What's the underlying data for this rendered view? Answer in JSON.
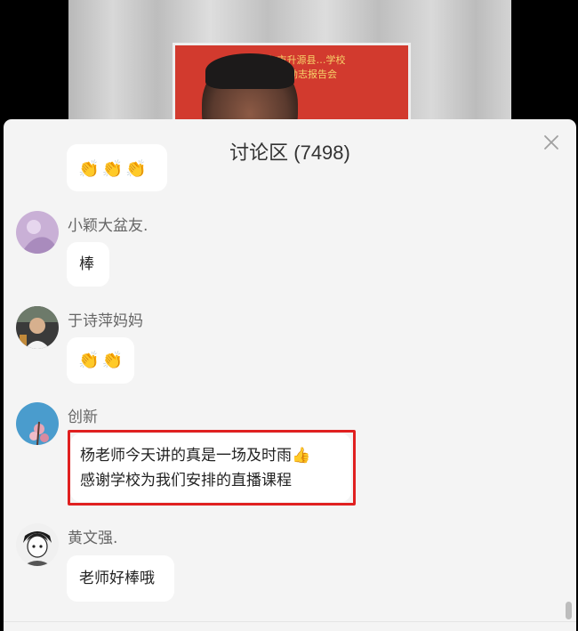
{
  "video": {
    "banner_line1": "齐齐哈尔市升源县…学校",
    "banner_line2": "20…线上励志报告会"
  },
  "panel": {
    "title": "讨论区 (7498)"
  },
  "messages": [
    {
      "name": "",
      "content": [
        "👏👏👏"
      ],
      "avatar": "none"
    },
    {
      "name": "小颖大盆友.",
      "content": [
        "棒"
      ],
      "avatar": "lilac-avatar"
    },
    {
      "name": "于诗萍妈妈",
      "content": [
        "👏👏"
      ],
      "avatar": "child-photo-avatar"
    },
    {
      "name": "创新",
      "content": [
        "杨老师今天讲的真是一场及时雨👍",
        "感谢学校为我们安排的直播课程"
      ],
      "avatar": "blossom-avatar"
    },
    {
      "name": "黄文强.",
      "content": [
        "老师好棒哦"
      ],
      "avatar": "anime-avatar"
    }
  ],
  "colors": {
    "panel_bg": "#f4f4f4",
    "bubble_bg": "#ffffff",
    "highlight_border": "#e02020",
    "username_text": "#666666"
  }
}
